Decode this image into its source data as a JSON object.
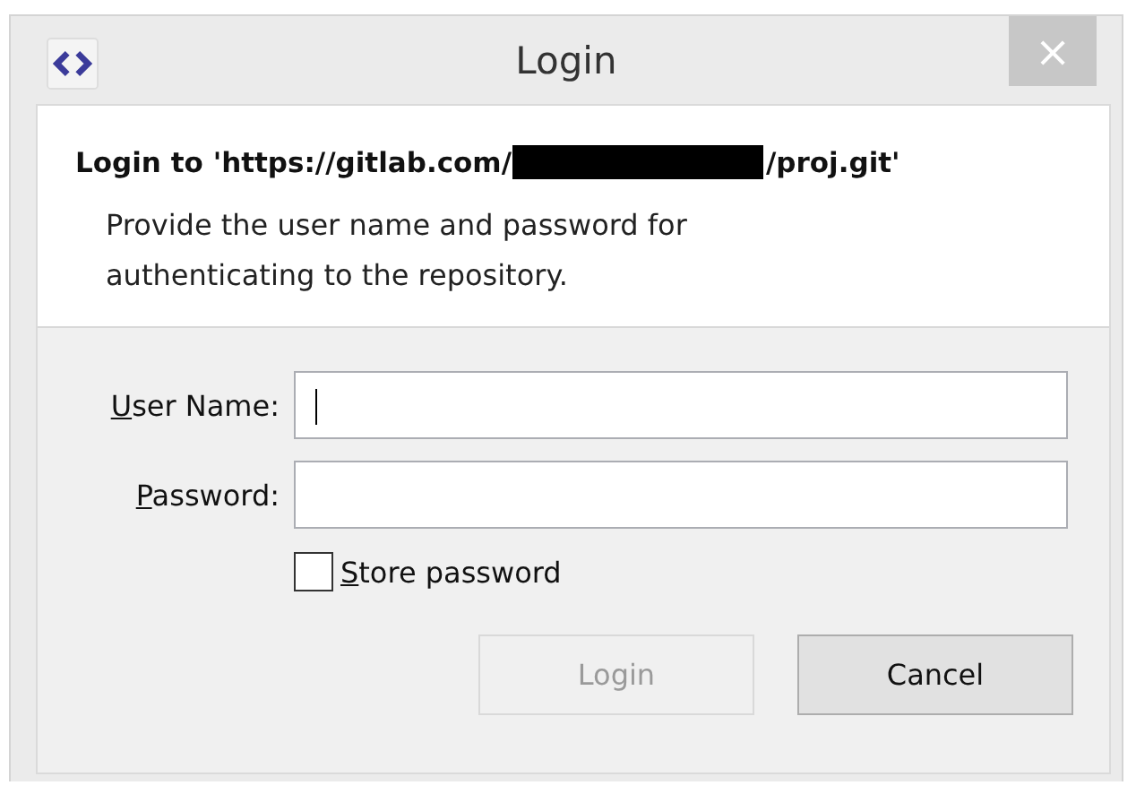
{
  "window": {
    "title": "Login",
    "close": "×"
  },
  "header": {
    "title_parts": [
      {
        "kind": "text",
        "text": "Login to 'https://gitlab.com/"
      },
      {
        "kind": "redacted"
      },
      {
        "kind": "text",
        "text": "/proj.git'"
      }
    ],
    "description": "Provide the user name and password for authenticating to the repository."
  },
  "fields": [
    {
      "label": "User Name:",
      "focused": true
    },
    {
      "label": "Password:",
      "focused": false
    }
  ],
  "store_password": {
    "label": "Store password",
    "checked": false
  },
  "buttons": [
    {
      "label": "Login",
      "disabled": true
    },
    {
      "label": "Cancel",
      "disabled": false
    }
  ]
}
